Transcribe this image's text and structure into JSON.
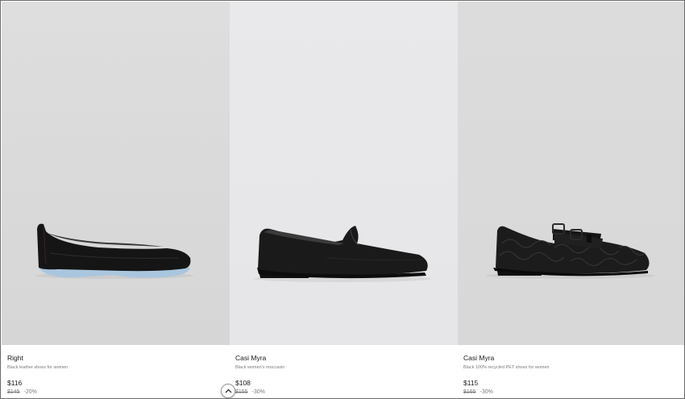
{
  "products": [
    {
      "name": "Right",
      "description": "Black leather shoes for women",
      "price": "$116",
      "original_price": "$145",
      "discount": "-20%",
      "image_icon": "ballet-flat-shoe-icon"
    },
    {
      "name": "Casi Myra",
      "description": "Black women's moccasin",
      "price": "$108",
      "original_price": "$155",
      "discount": "-30%",
      "image_icon": "moccasin-shoe-icon"
    },
    {
      "name": "Casi Myra",
      "description": "Black 100% recycled PET shoes for women",
      "price": "$115",
      "original_price": "$165",
      "discount": "-30%",
      "image_icon": "mary-jane-shoe-icon"
    }
  ],
  "scroll_top_icon": "chevron-up-icon",
  "colors": {
    "photo_bg_1": "#d9d9d9",
    "photo_bg_2": "#e6e6e8",
    "photo_bg_3": "#d8d8d8",
    "text": "#1a1a1a",
    "muted": "#7a7a7a"
  }
}
